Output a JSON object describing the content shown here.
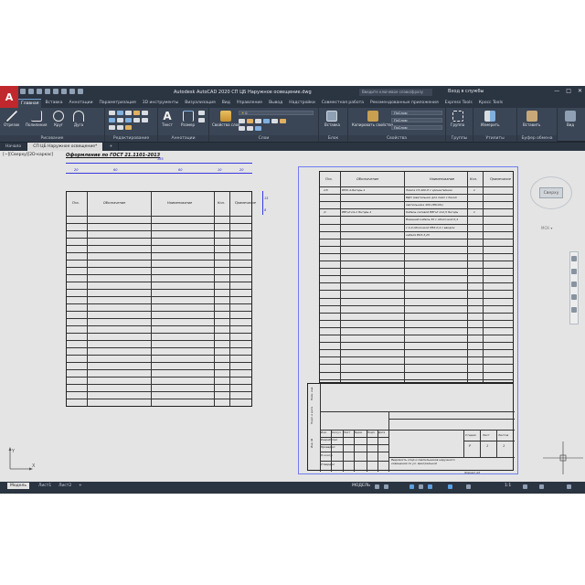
{
  "app": {
    "logo_letter": "A",
    "title": "Autodesk AutoCAD 2020   СП ЦБ Наружное освещение.dwg",
    "search_placeholder": "Введите ключевое слово/фразу",
    "user": "Вход в службы",
    "window_controls": [
      "—",
      "□",
      "✕"
    ]
  },
  "ribbon_tabs": [
    "Главная",
    "Вставка",
    "Аннотации",
    "Параметризация",
    "3D инструменты",
    "Визуализация",
    "Вид",
    "Управление",
    "Вывод",
    "Надстройки",
    "Совместная работа",
    "Рекомендованные приложения",
    "Express Tools",
    "Кросс Tools"
  ],
  "ribbon": {
    "draw_tools": [
      "Отрезок",
      "Полилиния",
      "Круг",
      "Дуга"
    ],
    "draw_label": "Рисование",
    "modify_label": "Редактирование",
    "annotation_tools": [
      "Текст",
      "Размер"
    ],
    "annotation_label": "Аннотации",
    "layers_tool": "Свойства слоя",
    "layers_label": "Слои",
    "insert_tool": "Вставка",
    "block_label": "Блок",
    "properties_tool": "Копировать свойства",
    "properties_combos": [
      "ПоСлою",
      "ПоСлою",
      "ПоСлою"
    ],
    "properties_label": "Свойства",
    "group_tool": "Группа",
    "groups_label": "Группы",
    "utilities_tool": "Измерить",
    "utilities_label": "Утилиты",
    "clipboard_tool": "Вставить",
    "clipboard_label": "Буфер обмена",
    "view_tool": "Вид",
    "layer_combo": "0"
  },
  "doc_tabs": [
    "Начало",
    "СП ЦБ Наружное освещение*",
    "+"
  ],
  "canvas": {
    "view_label": "[−][Сверху][2D-каркас]",
    "left_title": "Оформление по ГОСТ 21.1101-2013",
    "left_headers": [
      "Поз.",
      "Обозначение",
      "Наименование",
      "Кол.",
      "Примечание"
    ],
    "dims": [
      "20",
      "60",
      "60",
      "10",
      "20",
      "15",
      "8"
    ],
    "right_headers": [
      "Поз.",
      "Обозначение",
      "Наименование",
      "Кол.",
      "Примечание"
    ],
    "right_rows": [
      {
        "pos": "1/5",
        "code": "БПФ-4-Янтарь-1",
        "name": "Лампа СЗ-400-П с кронштейном",
        "qty": "1"
      },
      {
        "pos": "",
        "code": "",
        "name": "ВДО (светильник для ламп с базой",
        "qty": ""
      },
      {
        "pos": "",
        "code": "",
        "name": "светильника 400-1ВК101)",
        "qty": ""
      },
      {
        "pos": "/1",
        "code": "ВВГнГ-LS-1 Янтарь-1",
        "name": "Кабель силовой ВВГнГ 2х2,5 Янтарь",
        "qty": "1"
      },
      {
        "pos": "",
        "code": "",
        "name": "Внешний кабель 30 с оболочкой 0,4",
        "qty": ""
      },
      {
        "pos": "",
        "code": "",
        "name": "с 4-й оболочкой ПВХ-0,4 с вводом",
        "qty": ""
      },
      {
        "pos": "",
        "code": "",
        "name": "кабеля ВКЗ-3,25",
        "qty": ""
      }
    ],
    "stamp": {
      "signatures": [
        "Изм.",
        "Кол.уч",
        "Лист",
        "№док.",
        "Подп.",
        "Дата"
      ],
      "roles": [
        "Разработал",
        "Проверил",
        "Н.контр.",
        "Утвердил"
      ],
      "desc": "Ведомость опор и светильников наружного освещения по ул. Центральной",
      "sheet_hdr": [
        "Стадия",
        "Лист",
        "Листов"
      ],
      "sheet_vals": [
        "Р",
        "1",
        "1"
      ],
      "side": [
        "Инв. №",
        "Подп. и дата",
        "Взам. инв."
      ],
      "format": "Формат А3"
    },
    "viewcube": "Сверху",
    "wcs": "МСК ▾",
    "ucs_x": "X",
    "ucs_y": "Y"
  },
  "layout_tabs": [
    "Модель",
    "Лист1",
    "Лист2",
    "+"
  ],
  "status": {
    "model": "МОДЕЛЬ",
    "scale": "1:1",
    "icons": [
      "grid-icon",
      "snap-icon",
      "ortho-icon",
      "polar-icon",
      "osnap-icon",
      "lineweight-icon",
      "annotation-icon",
      "workspace-icon",
      "settings-icon",
      "customize-icon"
    ]
  }
}
